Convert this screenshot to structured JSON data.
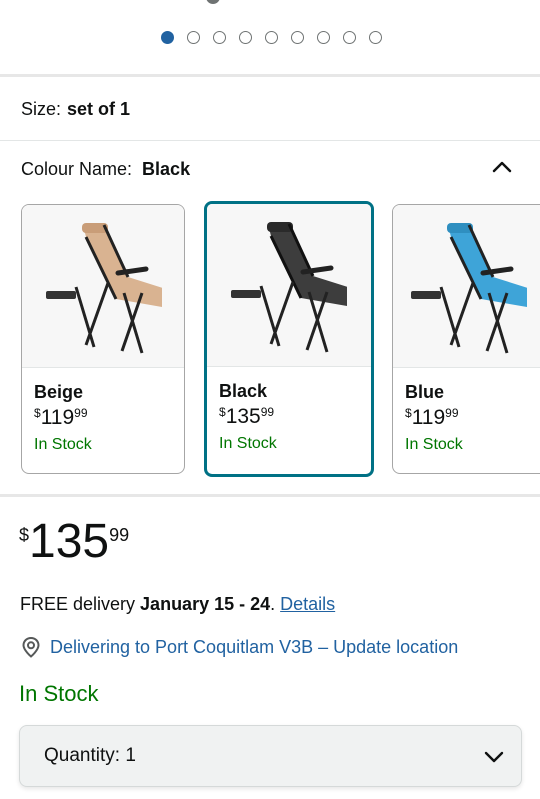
{
  "carousel": {
    "dot_count": 9,
    "active_index": 0
  },
  "size": {
    "label": "Size:",
    "value": "set of 1"
  },
  "colour": {
    "label": "Colour Name:",
    "value": "Black"
  },
  "swatches": [
    {
      "name": "Beige",
      "currency": "$",
      "whole": "119",
      "fraction": "99",
      "stock": "In Stock",
      "fabric": "#d9b391",
      "selected": false
    },
    {
      "name": "Black",
      "currency": "$",
      "whole": "135",
      "fraction": "99",
      "stock": "In Stock",
      "fabric": "#3d3d3d",
      "selected": true
    },
    {
      "name": "Blue",
      "currency": "$",
      "whole": "119",
      "fraction": "99",
      "stock": "In Stock",
      "fabric": "#3ea4d8",
      "selected": false
    }
  ],
  "price": {
    "currency": "$",
    "whole": "135",
    "fraction": "99"
  },
  "delivery": {
    "prefix": "FREE delivery ",
    "dates": "January 15 - 24",
    "suffix": ". ",
    "details_link": "Details"
  },
  "location": {
    "text": "Delivering to Port Coquitlam V3B – Update location"
  },
  "stock_status": "In Stock",
  "quantity": {
    "label": "Quantity:",
    "value": "1"
  },
  "colors": {
    "accent": "#007185",
    "link": "#2162a1",
    "in_stock": "#007600"
  }
}
